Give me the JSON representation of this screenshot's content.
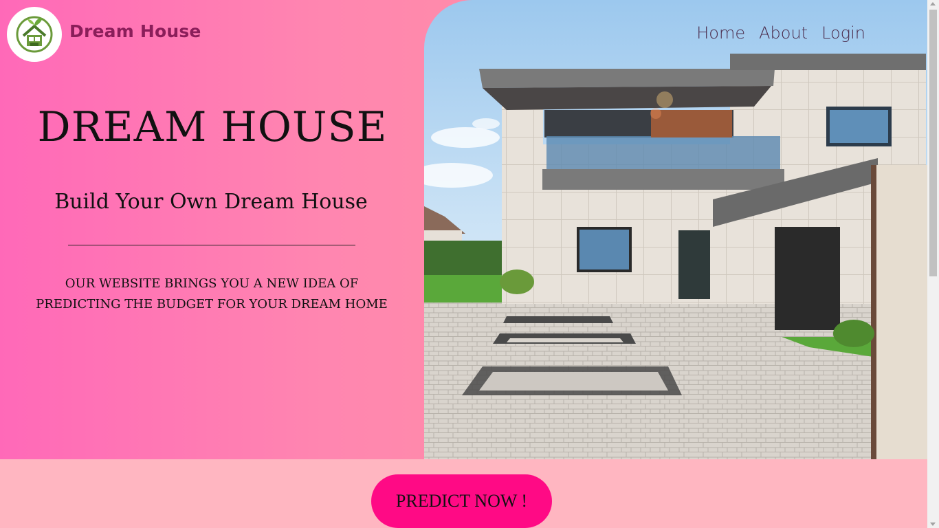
{
  "brand": {
    "name": "Dream House",
    "logo_icon": "house-leaf-logo"
  },
  "nav": {
    "items": [
      {
        "label": "Home"
      },
      {
        "label": "About"
      },
      {
        "label": "Login"
      }
    ]
  },
  "hero": {
    "title": "DREAM HOUSE",
    "subtitle": "Build Your Own Dream House",
    "description": "OUR WEBSITE BRINGS YOU A NEW IDEA OF PREDICTING THE BUDGET FOR YOUR DREAM HOME"
  },
  "cta": {
    "label": "PREDICT NOW !"
  },
  "colors": {
    "gradient_start": "#ff69b8",
    "gradient_end": "#ff9a98",
    "band": "#ffb6c1",
    "button": "#ff0a85",
    "brand_text": "#8a1e5a"
  }
}
